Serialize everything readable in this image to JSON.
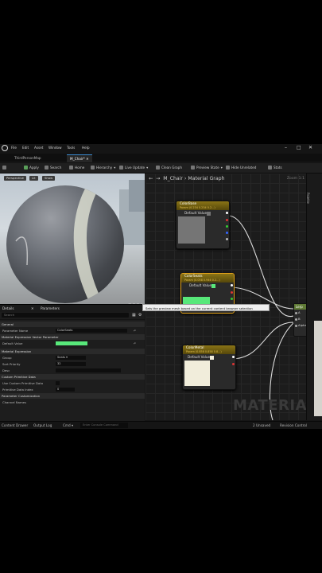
{
  "menu": {
    "items": [
      "File",
      "Edit",
      "Asset",
      "Window",
      "Tools",
      "Help"
    ],
    "window_controls": [
      "–",
      "□",
      "✕"
    ]
  },
  "tabs": [
    {
      "label": "ThirdPersonMap",
      "active": false
    },
    {
      "label": "M_Chair*",
      "active": true
    }
  ],
  "toolbar": {
    "save": "",
    "apply": "Apply",
    "search": "Search",
    "home": "Home",
    "hierarchy": "Hierarchy",
    "live_update": "Live Update",
    "clean_graph": "Clean Graph",
    "preview_state": "Preview State",
    "hide_unrelated": "Hide Unrelated",
    "stats": "Stats"
  },
  "viewport": {
    "perspective": "Perspective",
    "lit": "Lit",
    "show": "Show"
  },
  "details": {
    "tab_details": "Details",
    "tab_parameters": "Parameters",
    "search_placeholder": "Search",
    "sections": {
      "general": "General",
      "mevp": "Material Expression Vector Parameter",
      "me": "Material Expression",
      "cpd": "Custom Primitive Data",
      "pc": "Parameter Customization"
    },
    "rows": {
      "parameter_name_label": "Parameter Name",
      "parameter_name_value": "ColorSeats",
      "default_value_label": "Default Value",
      "default_value_color": "#58e87a",
      "group_label": "Group",
      "group_value": "Seats",
      "sort_priority_label": "Sort Priority",
      "sort_priority_value": "32",
      "desc_label": "Desc",
      "use_custom_label": "Use Custom Primitive Data",
      "primitive_index_label": "Primitive Data Index",
      "primitive_index_value": "0",
      "channel_names_label": "Channel Names"
    }
  },
  "graph": {
    "back": "←",
    "forward": "→",
    "breadcrumb_root": "M_Chair",
    "breadcrumb_sep": "›",
    "breadcrumb_leaf": "Material Graph",
    "zoom": "Zoom 1:1",
    "palette_label": "Palette",
    "watermark": "MATERIAL",
    "tooltip": "Sets the preview mesh based on the current content browser selection",
    "nodes": [
      {
        "title": "ColorBase",
        "subtitle": "Param (0.234 0.234 0.2...)",
        "row_label": "Default Value",
        "swatch": "#757575"
      },
      {
        "title": "ColorSeats",
        "subtitle": "Param (0.058 0.946 0.2...)",
        "row_label": "Default Value",
        "swatch": "#58e87a"
      },
      {
        "title": "ColorMetal",
        "subtitle": "Param (0.858 0.858 0.8...)",
        "row_label": "Default Value",
        "swatch": "#f1eddb"
      }
    ],
    "lerp": {
      "title": "Lerp",
      "pins": [
        "A",
        "B",
        "Alpha"
      ]
    }
  },
  "status": {
    "content_drawer": "Content Drawer",
    "output_log": "Output Log",
    "cmd": "Cmd",
    "cmd_placeholder": "Enter Console Command",
    "unsaved": "2 Unsaved",
    "revision_control": "Revision Control"
  },
  "colors": {
    "accent_blue": "#3d8bd1",
    "node_selected": "#e2a21a",
    "node_header": "#8a7416",
    "lerp_header": "#5f7a35"
  }
}
